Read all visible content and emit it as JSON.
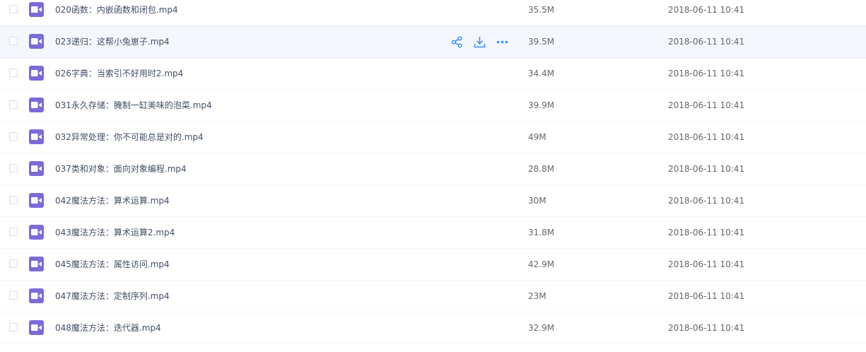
{
  "colors": {
    "file_icon": "#7b6ad7",
    "action_icon": "#3b8cff",
    "hover_row": "#f4f8fe",
    "text": "#424e67"
  },
  "files": [
    {
      "name": "020函数：内嵌函数和闭包.mp4",
      "size": "35.5M",
      "date": "2018-06-11 10:41",
      "icon": "video-file-icon"
    },
    {
      "name": "023递归：这帮小兔崽子.mp4",
      "size": "39.5M",
      "date": "2018-06-11 10:41",
      "icon": "video-file-icon",
      "hover": true
    },
    {
      "name": "026字典：当索引不好用时2.mp4",
      "size": "34.4M",
      "date": "2018-06-11 10:41",
      "icon": "video-file-icon"
    },
    {
      "name": "031永久存储：腌制一缸美味的泡菜.mp4",
      "size": "39.9M",
      "date": "2018-06-11 10:41",
      "icon": "video-file-icon"
    },
    {
      "name": "032异常处理：你不可能总是对的.mp4",
      "size": "49M",
      "date": "2018-06-11 10:41",
      "icon": "video-file-icon"
    },
    {
      "name": "037类和对象：面向对象编程.mp4",
      "size": "28.8M",
      "date": "2018-06-11 10:41",
      "icon": "video-file-icon"
    },
    {
      "name": "042魔法方法：算术运算.mp4",
      "size": "30M",
      "date": "2018-06-11 10:41",
      "icon": "video-file-icon"
    },
    {
      "name": "043魔法方法：算术运算2.mp4",
      "size": "31.8M",
      "date": "2018-06-11 10:41",
      "icon": "video-file-icon"
    },
    {
      "name": "045魔法方法：属性访问.mp4",
      "size": "42.9M",
      "date": "2018-06-11 10:41",
      "icon": "video-file-icon"
    },
    {
      "name": "047魔法方法：定制序列.mp4",
      "size": "23M",
      "date": "2018-06-11 10:41",
      "icon": "video-file-icon"
    },
    {
      "name": "048魔法方法：迭代器.mp4",
      "size": "32.9M",
      "date": "2018-06-11 10:41",
      "icon": "video-file-icon"
    }
  ],
  "row_actions": [
    {
      "icon": "share-icon"
    },
    {
      "icon": "download-icon"
    },
    {
      "icon": "more-icon"
    }
  ]
}
